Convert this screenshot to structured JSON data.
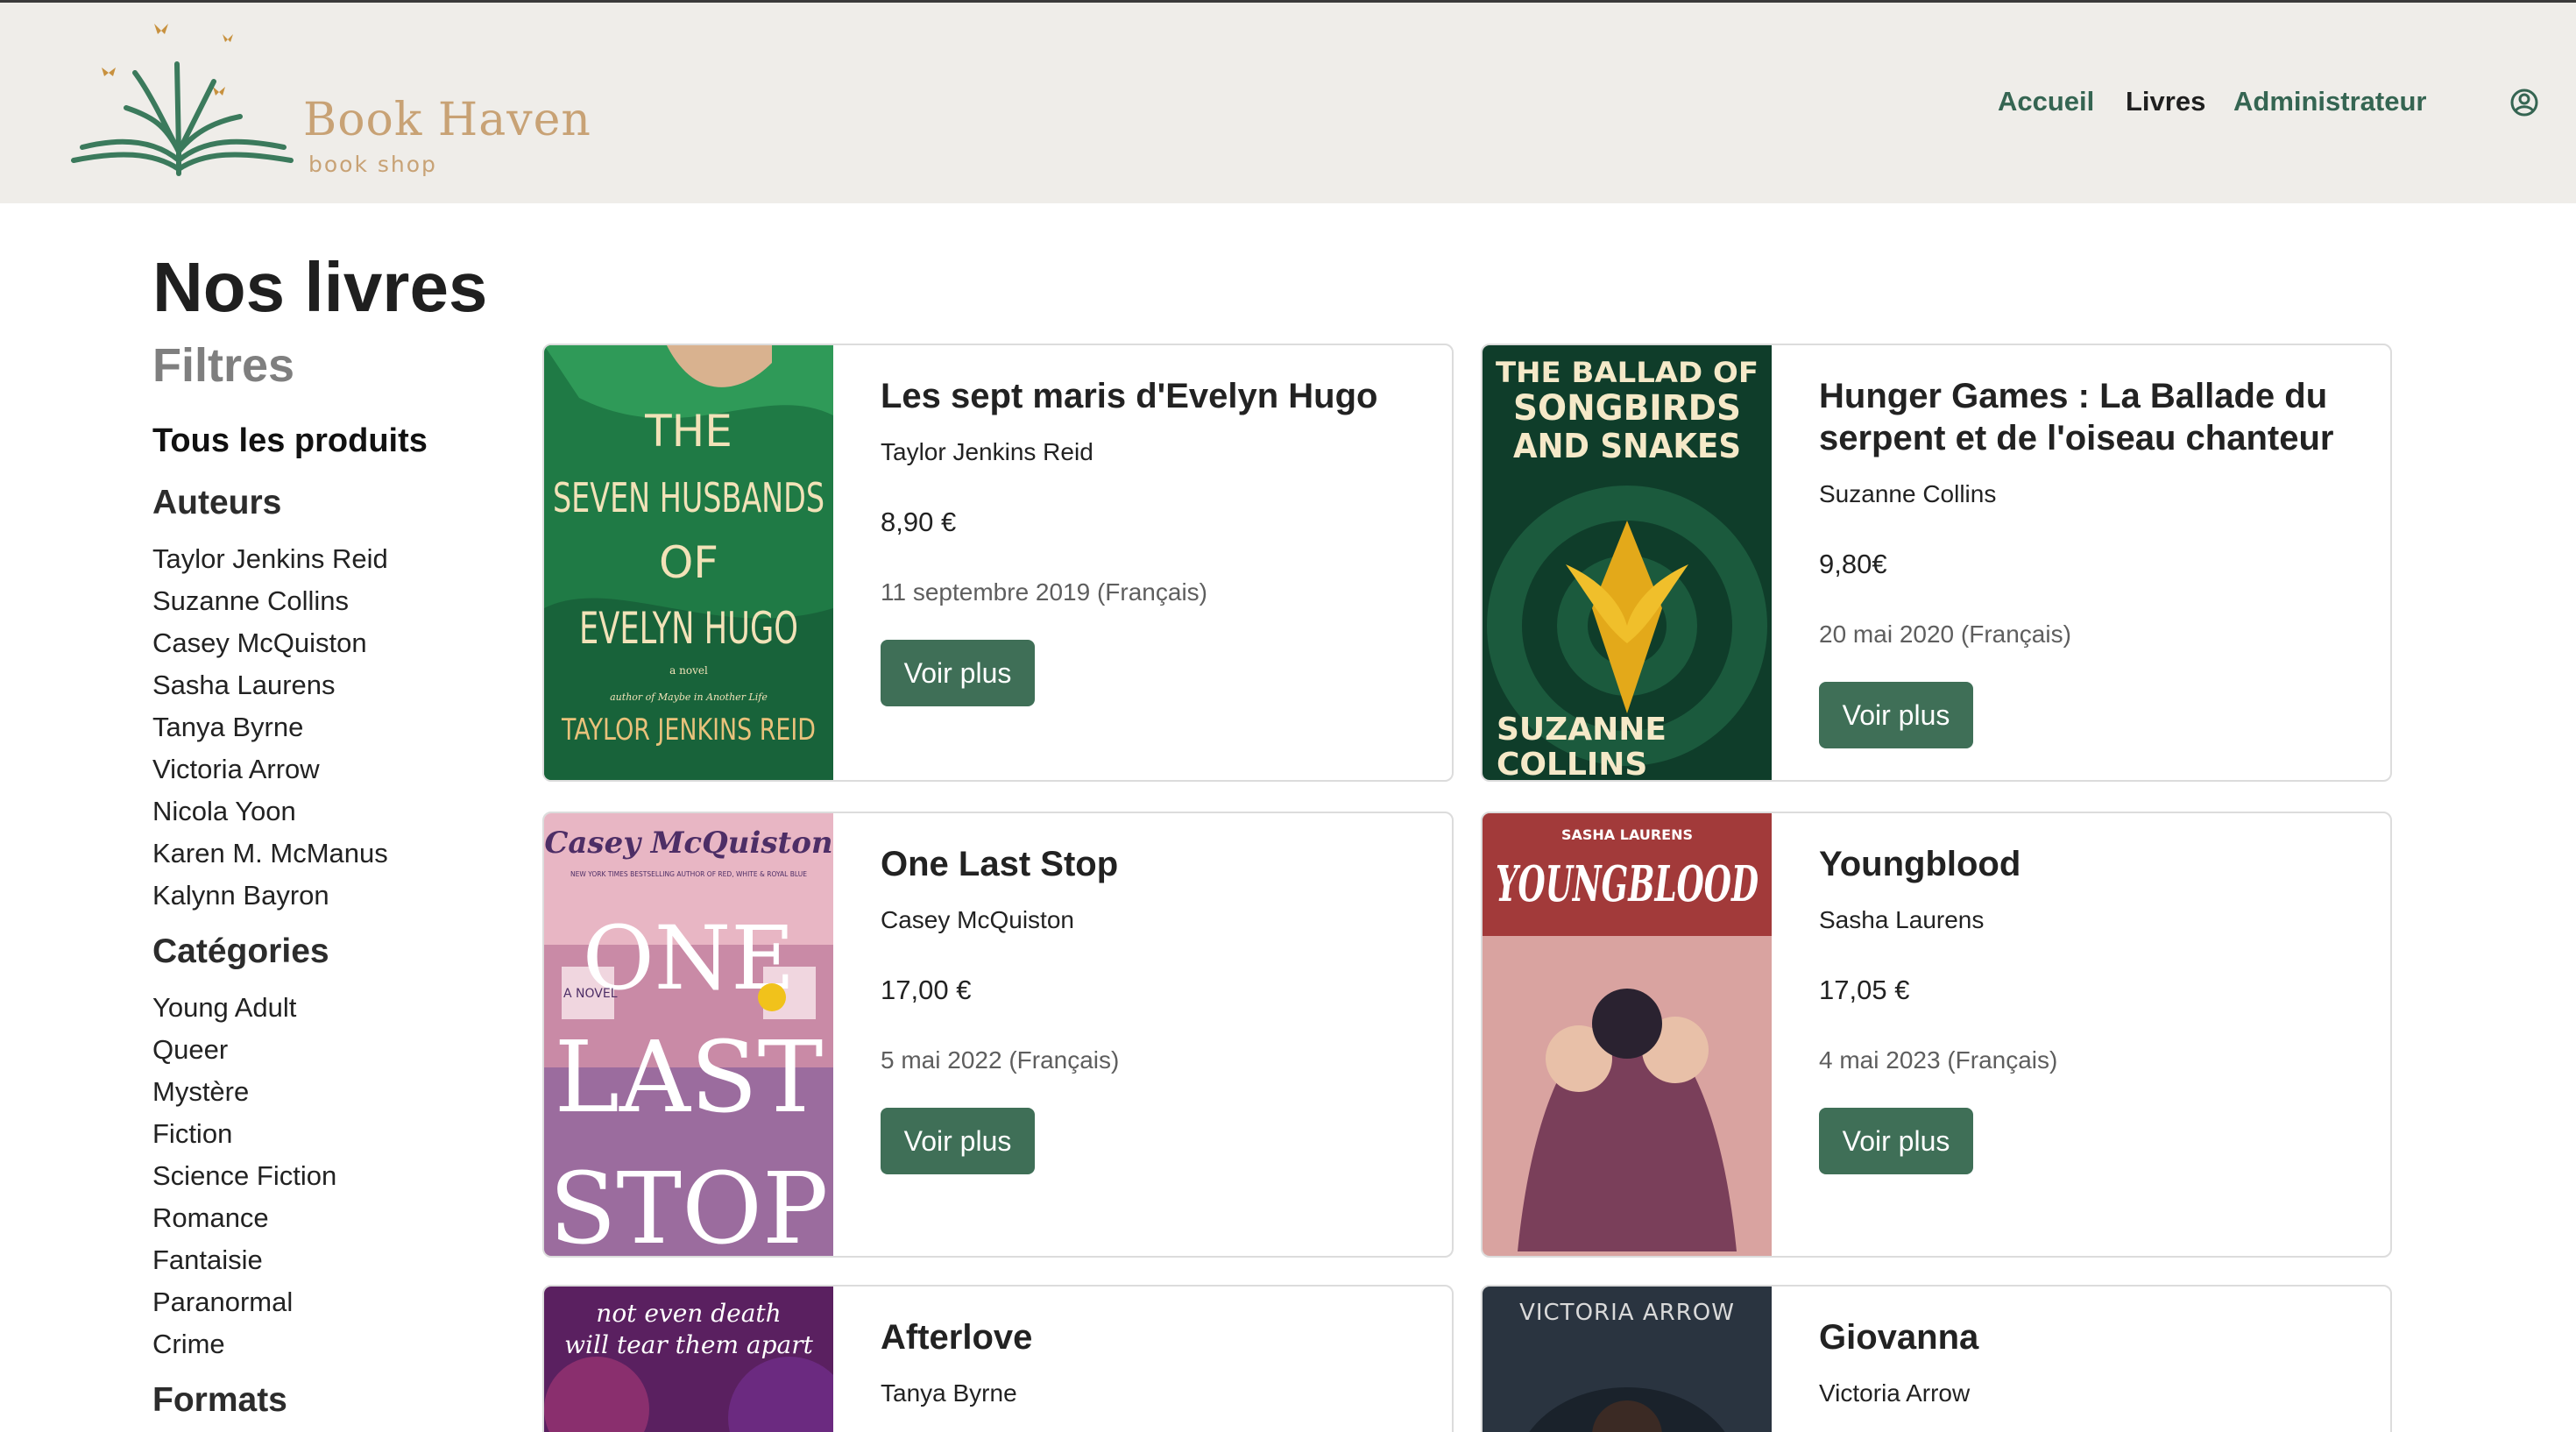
{
  "brand": {
    "name": "Book Haven",
    "tagline": "book shop",
    "icon": "open-book-butterflies-logo"
  },
  "nav": {
    "home": "Accueil",
    "books": "Livres",
    "admin": "Administrateur",
    "user_icon": "user-circle-icon",
    "accent": "#356552"
  },
  "page_title": "Nos livres",
  "sidebar": {
    "filters_title": "Filtres",
    "all_products": "Tous les produits",
    "authors_title": "Auteurs",
    "authors": [
      "Taylor Jenkins Reid",
      "Suzanne Collins",
      "Casey McQuiston",
      "Sasha Laurens",
      "Tanya Byrne",
      "Victoria Arrow",
      "Nicola Yoon",
      "Karen M. McManus",
      "Kalynn Bayron"
    ],
    "categories_title": "Catégories",
    "categories": [
      "Young Adult",
      "Queer",
      "Mystère",
      "Fiction",
      "Science Fiction",
      "Romance",
      "Fantaisie",
      "Paranormal",
      "Crime"
    ],
    "formats_title": "Formats"
  },
  "books": [
    {
      "title": "Les sept maris d'Evelyn Hugo",
      "author": "Taylor Jenkins Reid",
      "price": "8,90 €",
      "date": "11 septembre 2019 (Français)",
      "button": "Voir plus",
      "cover": {
        "lines": [
          "THE",
          "SEVEN HUSBANDS",
          "OF",
          "EVELYN HUGO"
        ],
        "novel": "a novel",
        "byline": "author of Maybe in Another Life",
        "author": "TAYLOR JENKINS REID",
        "color": "#1f7a45"
      }
    },
    {
      "title": "Hunger Games : La Ballade du serpent et de l'oiseau chanteur",
      "author": "Suzanne Collins",
      "price": "9,80€",
      "date": "20 mai 2020 (Français)",
      "button": "Voir plus",
      "cover": {
        "lines": [
          "THE BALLAD OF",
          "SONGBIRDS",
          "AND SNAKES"
        ],
        "author1": "SUZANNE",
        "author2": "COLLINS",
        "color": "#0f3d2a"
      }
    },
    {
      "title": "One Last Stop",
      "author": "Casey McQuiston",
      "price": "17,00 €",
      "date": "5 mai 2022 (Français)",
      "button": "Voir plus",
      "cover": {
        "author": "Casey McQuiston",
        "tagline": "NEW YORK TIMES BESTSELLING AUTHOR OF RED, WHITE & ROYAL BLUE",
        "lines": [
          "ONE",
          "LAST",
          "STOP"
        ],
        "badge": "A NOVEL",
        "color": "#e8b6c4"
      }
    },
    {
      "title": "Youngblood",
      "author": "Sasha Laurens",
      "price": "17,05 €",
      "date": "4 mai 2023 (Français)",
      "button": "Voir plus",
      "cover": {
        "author": "SASHA LAURENS",
        "title": "YOUNGBLOOD",
        "color": "#a23a3a"
      }
    },
    {
      "title": "Afterlove",
      "author": "Tanya Byrne",
      "cover": {
        "line1": "not even death",
        "line2": "will tear them apart",
        "color": "#5a2060"
      }
    },
    {
      "title": "Giovanna",
      "author": "Victoria Arrow",
      "cover": {
        "author": "VICTORIA ARROW",
        "color": "#2a3440"
      }
    }
  ]
}
